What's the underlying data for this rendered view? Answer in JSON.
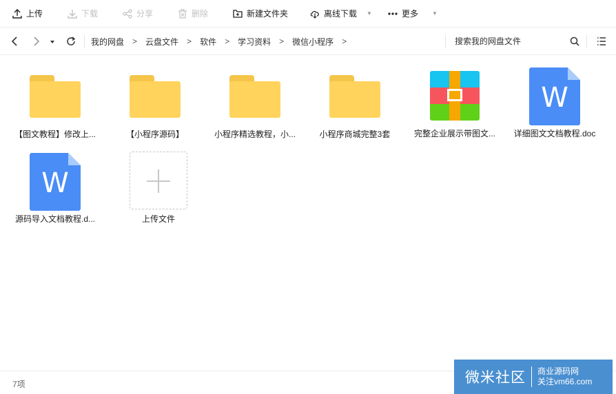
{
  "toolbar": {
    "upload": "上传",
    "download": "下载",
    "share": "分享",
    "delete": "删除",
    "new_folder": "新建文件夹",
    "offline_download": "离线下载",
    "more": "更多"
  },
  "nav": {
    "breadcrumbs": [
      "我的网盘",
      "云盘文件",
      "软件",
      "学习资料",
      "微信小程序"
    ],
    "search_placeholder": "搜索我的网盘文件"
  },
  "files": [
    {
      "name": "【图文教程】修改上...",
      "type": "folder"
    },
    {
      "name": "【小程序源码】",
      "type": "folder"
    },
    {
      "name": "小程序精选教程，小...",
      "type": "folder"
    },
    {
      "name": "小程序商城完整3套",
      "type": "folder"
    },
    {
      "name": "完整企业展示带图文...",
      "type": "archive"
    },
    {
      "name": "详细图文文档教程.doc",
      "type": "word",
      "letter": "W"
    },
    {
      "name": "源码导入文档教程.d...",
      "type": "word",
      "letter": "W"
    }
  ],
  "upload_tile": {
    "label": "上传文件"
  },
  "status": {
    "count": "7项"
  },
  "watermark": {
    "logo": "微米社区",
    "line1": "商业源码网",
    "line2": "关注vm66.com"
  },
  "colors": {
    "folder": "#ffd35c",
    "word": "#4a8df6",
    "archive_top": "#18c4f0",
    "archive_mid": "#f7555e",
    "archive_bottom": "#5fd119",
    "archive_strap": "#f6a700",
    "watermark": "#4a8fd0"
  }
}
